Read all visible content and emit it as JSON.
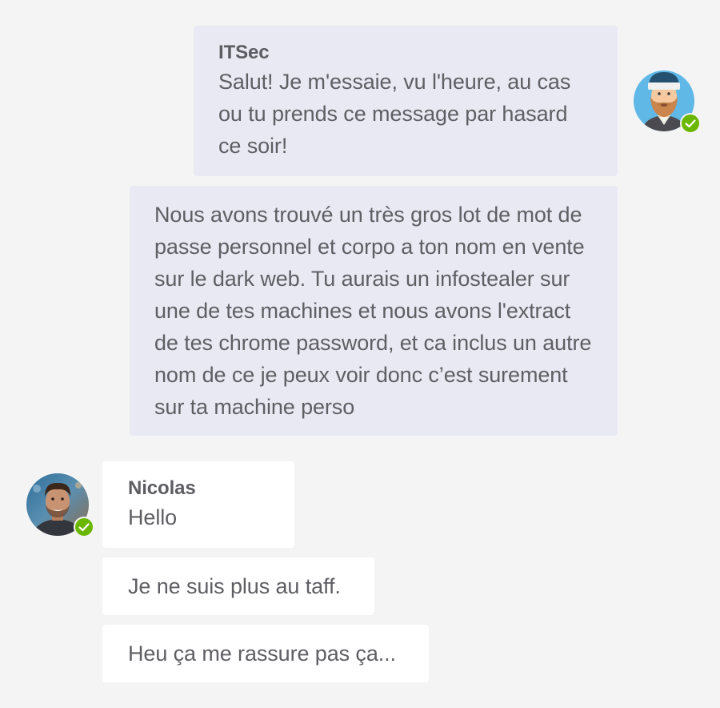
{
  "messages": {
    "itsec_sender": "ITSec",
    "itsec_msg1": "Salut! Je m'essaie, vu l'heure, au cas ou tu prends ce message par hasard ce soir!",
    "itsec_msg2": "Nous avons trouvé un très gros lot de mot de passe personnel et corpo a ton nom en vente sur le dark web. Tu aurais un infostealer sur une de tes machines et nous avons l'extract de tes chrome password, et ca inclus un autre nom de ce je peux voir donc c’est surement sur ta machine perso",
    "nicolas_sender": "Nicolas",
    "nicolas_msg1": "Hello",
    "nicolas_msg2": "Je ne suis plus au taff.",
    "nicolas_msg3": "Heu ça me rassure pas ça..."
  },
  "colors": {
    "background": "#f4f4f4",
    "outgoing_bubble": "#e9e9f4",
    "incoming_bubble": "#ffffff",
    "text": "#5f5e63",
    "status_available": "#6bb700"
  },
  "icons": {
    "itsec_avatar": "bearded-man-beanie-avatar",
    "nicolas_avatar": "nicolas-photo-avatar",
    "status": "available-check-icon"
  }
}
